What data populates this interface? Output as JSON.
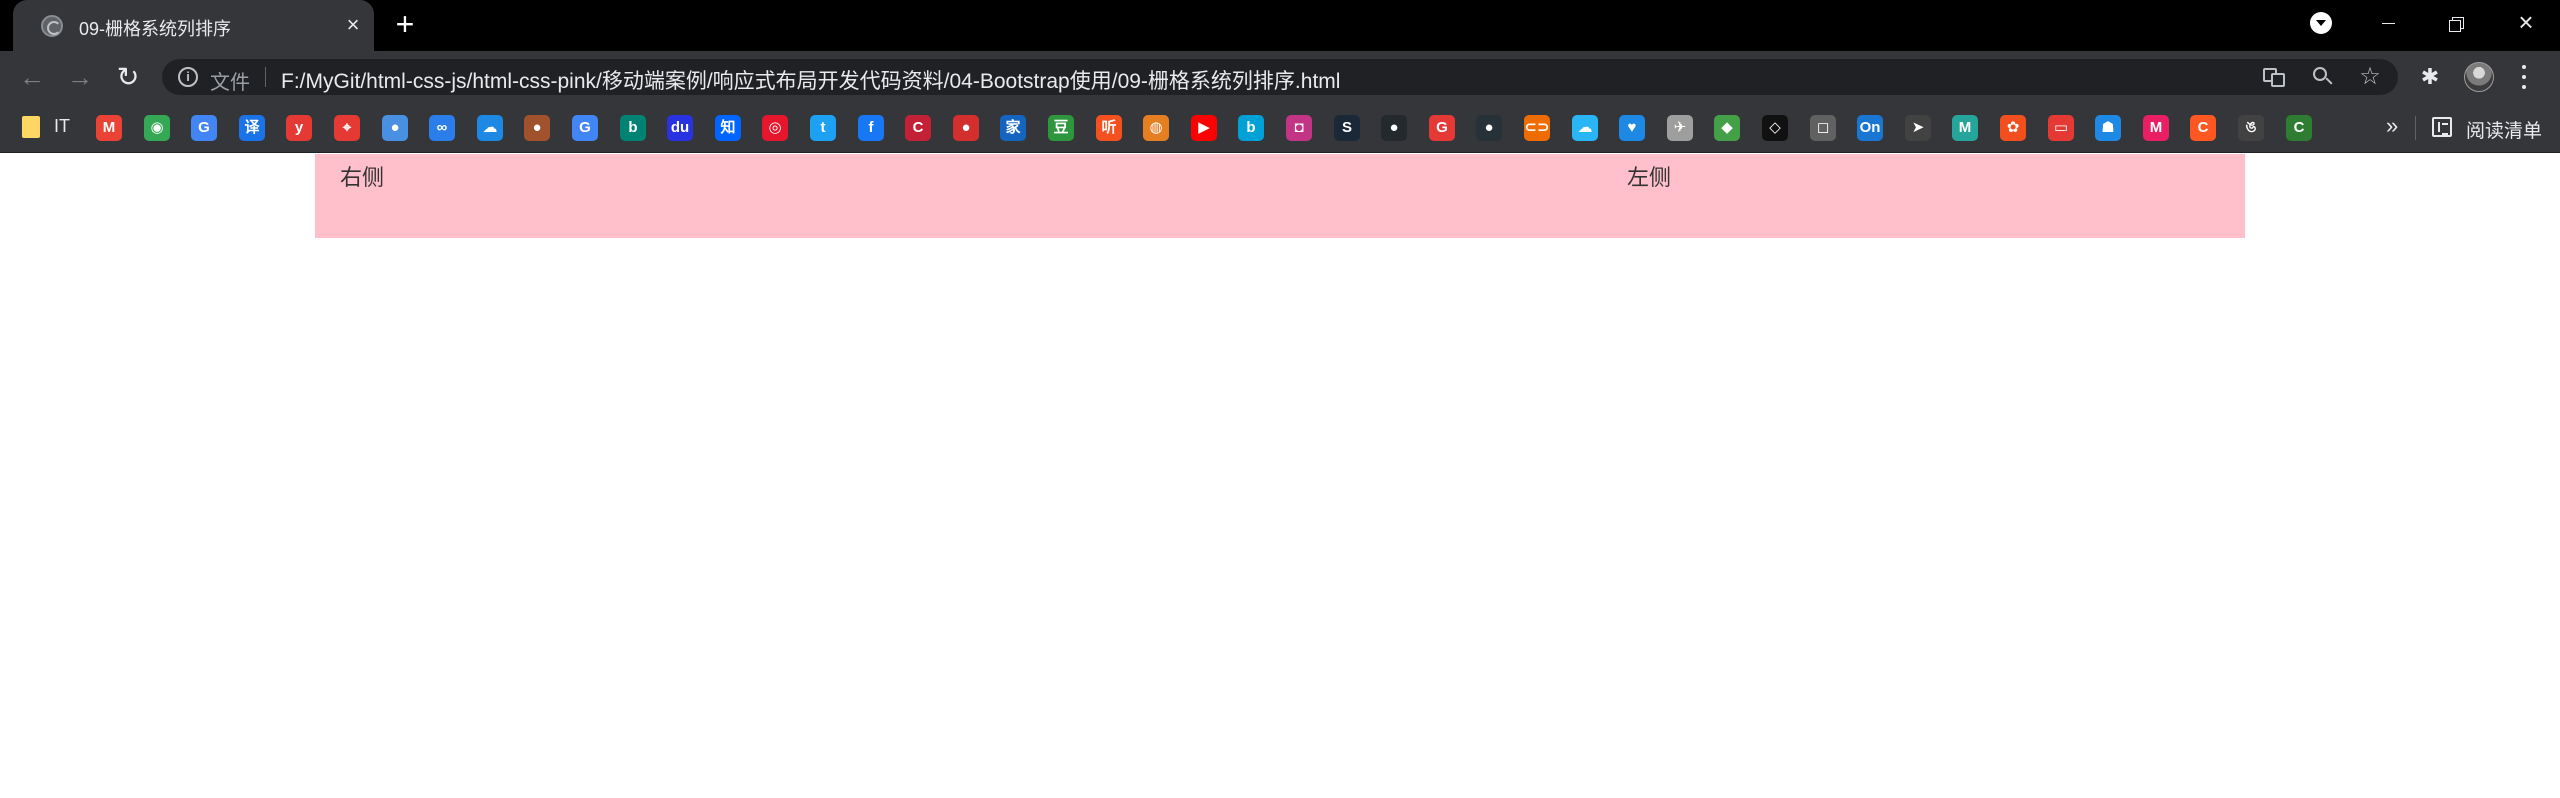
{
  "window": {
    "tab_title": "09-栅格系统列排序",
    "tab_close": "×",
    "new_tab": "+",
    "win_close": "×"
  },
  "toolbar": {
    "back": "←",
    "forward": "→",
    "reload": "↻",
    "info": "i",
    "file_label": "文件",
    "url": "F:/MyGit/html-css-js/html-css-pink/移动端案例/响应式布局开发代码资料/04-Bootstrap使用/09-栅格系统列排序.html",
    "star": "☆",
    "extensions": "✱"
  },
  "bookmarks": {
    "folder_label": "IT",
    "items": [
      {
        "name": "gmail-icon",
        "glyph": "M",
        "color": "#ea4335"
      },
      {
        "name": "chrome-icon",
        "glyph": "◉",
        "color": "#34a853"
      },
      {
        "name": "translate-bookmark-icon",
        "glyph": "G",
        "color": "#4285f4"
      },
      {
        "name": "youdao-translate-icon",
        "glyph": "译",
        "color": "#1a73e8"
      },
      {
        "name": "youdao-icon",
        "glyph": "y",
        "color": "#e53935"
      },
      {
        "name": "maps-icon",
        "glyph": "⌖",
        "color": "#e53935"
      },
      {
        "name": "globe-icon",
        "glyph": "●",
        "color": "#4a90e2"
      },
      {
        "name": "baidu-netdisk-icon",
        "glyph": "∞",
        "color": "#2b7de9"
      },
      {
        "name": "cloud-icon",
        "glyph": "☁",
        "color": "#1e88e5"
      },
      {
        "name": "acorn-icon",
        "glyph": "●",
        "color": "#a0522d"
      },
      {
        "name": "google-icon",
        "glyph": "G",
        "color": "#4285f4"
      },
      {
        "name": "bing-icon",
        "glyph": "b",
        "color": "#008373"
      },
      {
        "name": "baidu-icon",
        "glyph": "du",
        "color": "#2932e1"
      },
      {
        "name": "zhihu-icon",
        "glyph": "知",
        "color": "#0066ff"
      },
      {
        "name": "weibo-icon",
        "glyph": "◎",
        "color": "#e6162d"
      },
      {
        "name": "twitter-icon",
        "glyph": "t",
        "color": "#1da1f2"
      },
      {
        "name": "facebook-icon",
        "glyph": "f",
        "color": "#1877f2"
      },
      {
        "name": "csdn-icon",
        "glyph": "C",
        "color": "#c32136"
      },
      {
        "name": "red-circle-icon",
        "glyph": "●",
        "color": "#d32f2f"
      },
      {
        "name": "jia-icon",
        "glyph": "家",
        "color": "#1565c0"
      },
      {
        "name": "douban-icon",
        "glyph": "豆",
        "color": "#2e963d"
      },
      {
        "name": "ting-icon",
        "glyph": "听",
        "color": "#f4511e"
      },
      {
        "name": "monkey-icon",
        "glyph": "◍",
        "color": "#e67e22"
      },
      {
        "name": "youtube-icon",
        "glyph": "▶",
        "color": "#ff0000"
      },
      {
        "name": "bilibili-icon",
        "glyph": "b",
        "color": "#00a1d6"
      },
      {
        "name": "instagram-icon",
        "glyph": "◘",
        "color": "#c13584"
      },
      {
        "name": "steam-icon",
        "glyph": "S",
        "color": "#1b2838"
      },
      {
        "name": "github-icon",
        "glyph": "●",
        "color": "#24292e"
      },
      {
        "name": "g-red-icon",
        "glyph": "G",
        "color": "#e53935"
      },
      {
        "name": "dark-circle-icon",
        "glyph": "●",
        "color": "#263238"
      },
      {
        "name": "link-icon",
        "glyph": "⊂⊃",
        "color": "#ef6c00"
      },
      {
        "name": "cloud-outline-icon",
        "glyph": "☁",
        "color": "#29b6f6"
      },
      {
        "name": "teal-bird-icon",
        "glyph": "♥",
        "color": "#1e88e5"
      },
      {
        "name": "rocket-icon",
        "glyph": "✈",
        "color": "#9e9e9e"
      },
      {
        "name": "ufo-icon",
        "glyph": "◆",
        "color": "#43a047"
      },
      {
        "name": "codepen-icon",
        "glyph": "◇",
        "color": "#111111"
      },
      {
        "name": "cube-icon",
        "glyph": "◻",
        "color": "#616161"
      },
      {
        "name": "on-icon",
        "glyph": "On",
        "color": "#1976d2"
      },
      {
        "name": "white-arrow-icon",
        "glyph": "➤",
        "color": "#424242"
      },
      {
        "name": "m-green-icon",
        "glyph": "M",
        "color": "#26a69a"
      },
      {
        "name": "figma-icon",
        "glyph": "✿",
        "color": "#f24e1e"
      },
      {
        "name": "box-red-icon",
        "glyph": "▭",
        "color": "#e53935"
      },
      {
        "name": "ghost-icon",
        "glyph": "☗",
        "color": "#1e88e5"
      },
      {
        "name": "m-red-icon",
        "glyph": "M",
        "color": "#e91e63"
      },
      {
        "name": "c-orange-icon",
        "glyph": "C",
        "color": "#ff5722"
      },
      {
        "name": "script-icon",
        "glyph": "ঙ",
        "color": "#424242"
      },
      {
        "name": "c-green-icon",
        "glyph": "C",
        "color": "#2e7d32"
      }
    ],
    "more": "»",
    "reading_list_label": "阅读清单"
  },
  "page": {
    "row_background": "#ffc0cb",
    "col_right_text": "右侧",
    "col_left_text": "左侧"
  }
}
